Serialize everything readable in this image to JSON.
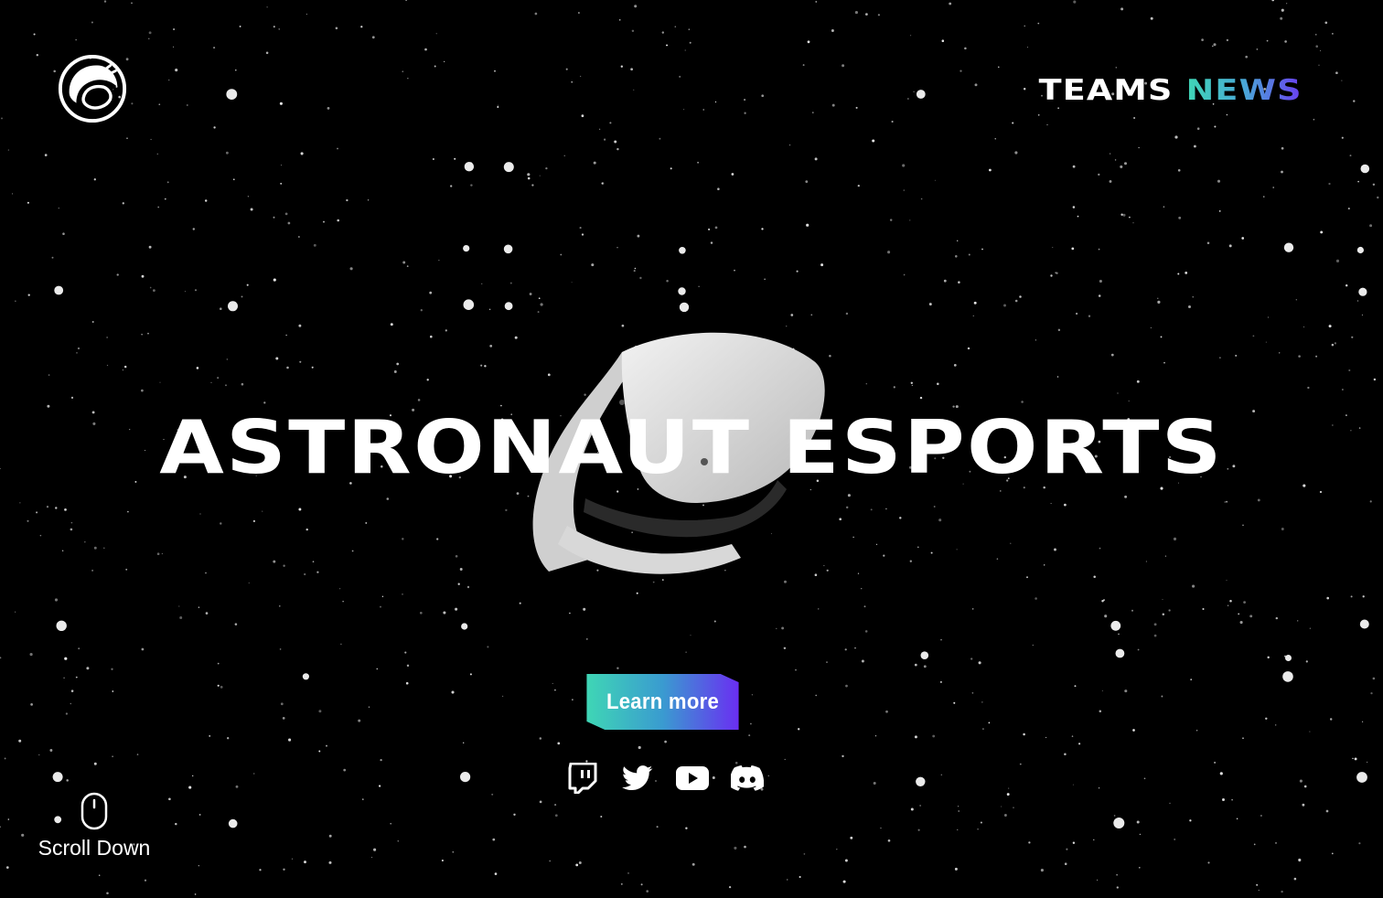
{
  "header": {
    "logo": "astronaut-helmet-logo",
    "nav": [
      {
        "label": "TEAMS",
        "active": false
      },
      {
        "label": "NEWS",
        "active": true
      }
    ]
  },
  "hero": {
    "title": "ASTRONAUT ESPORTS",
    "image": "vr-headset",
    "cta_label": "Learn more"
  },
  "social": [
    {
      "icon": "twitch-icon"
    },
    {
      "icon": "twitter-icon"
    },
    {
      "icon": "youtube-icon"
    },
    {
      "icon": "discord-icon"
    }
  ],
  "scroll_hint": {
    "icon": "mouse-icon",
    "label": "Scroll Down"
  },
  "colors": {
    "background": "#000000",
    "text": "#ffffff",
    "gradient_start": "#3fd6b5",
    "gradient_mid": "#3a9bd0",
    "gradient_end": "#6a2ef2"
  }
}
